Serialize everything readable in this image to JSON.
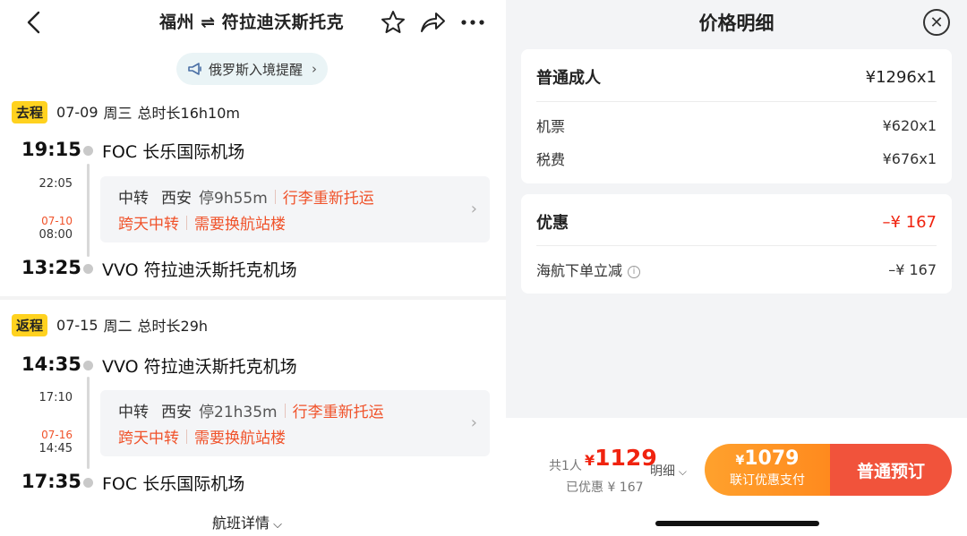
{
  "header": {
    "title": "福州 ⇌ 符拉迪沃斯托克",
    "back_icon": "chevron-left-icon",
    "icons": [
      "star-icon",
      "share-icon",
      "more-icon"
    ]
  },
  "notice": {
    "text": "俄罗斯入境提醒",
    "icon": "megaphone-icon"
  },
  "outbound": {
    "tag": "去程",
    "date": "07-09",
    "weekday": "周三",
    "duration": "总时长16h10m",
    "dep_time": "19:15",
    "dep_airport": "FOC 长乐国际机场",
    "arr_leg1_time": "22:05",
    "next_day_date": "07-10",
    "dep_leg2_time": "08:00",
    "transfer": {
      "label": "中转",
      "city": "西安",
      "stay": "停9h55m",
      "baggage": "行李重新托运",
      "overnight": "跨天中转",
      "terminal": "需要换航站楼"
    },
    "arr_time": "13:25",
    "arr_airport": "VVO 符拉迪沃斯托克机场"
  },
  "return": {
    "tag": "返程",
    "date": "07-15",
    "weekday": "周二",
    "duration": "总时长29h",
    "dep_time": "14:35",
    "dep_airport": "VVO 符拉迪沃斯托克机场",
    "arr_leg1_time": "17:10",
    "next_day_date": "07-16",
    "dep_leg2_time": "14:45",
    "transfer": {
      "label": "中转",
      "city": "西安",
      "stay": "停21h35m",
      "baggage": "行李重新托运",
      "overnight": "跨天中转",
      "terminal": "需要换航站楼"
    },
    "arr_time": "17:35",
    "arr_airport": "FOC 长乐国际机场"
  },
  "flight_details_link": "航班详情",
  "price_panel": {
    "title": "价格明细",
    "adult": {
      "label": "普通成人",
      "value": "¥1296x1"
    },
    "ticket": {
      "label": "机票",
      "value": "¥620x1"
    },
    "tax": {
      "label": "税费",
      "value": "¥676x1"
    },
    "discount": {
      "label": "优惠",
      "value": "–¥ 167"
    },
    "instant": {
      "label": "海航下单立减",
      "value": "–¥ 167"
    }
  },
  "footer": {
    "count": "共1人",
    "yen": "¥",
    "price": "1129",
    "saved": "已优惠 ¥ 167",
    "detail": "明细",
    "combo_yen": "¥",
    "combo_price": "1079",
    "combo_label": "联订优惠支付",
    "book_label": "普通预订"
  },
  "colors": {
    "accent_red": "#f0532b",
    "tag_yellow": "#ffd21f",
    "combo_orange": "#ff9a28",
    "book_red": "#f1533b"
  }
}
